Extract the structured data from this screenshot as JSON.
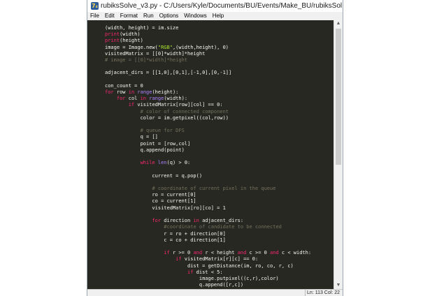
{
  "window": {
    "title": "rubiksSolve_v3.py - C:/Users/Kyle/Documents/BU/Events/Make_BU/rubiksSol..."
  },
  "menu": [
    "File",
    "Edit",
    "Format",
    "Run",
    "Options",
    "Windows",
    "Help"
  ],
  "code_lines": [
    [
      {
        "t": "(width, height) = im.size"
      }
    ],
    [
      {
        "t": "print",
        "c": "kw"
      },
      {
        "t": "(width)"
      }
    ],
    [
      {
        "t": "print",
        "c": "kw"
      },
      {
        "t": "(height)"
      }
    ],
    [
      {
        "t": "image = Image.new("
      },
      {
        "t": "\"RGB\"",
        "c": "str"
      },
      {
        "t": ",(width,height), 0)"
      }
    ],
    [
      {
        "t": "visitedMatrix = [[0]*width]*height"
      }
    ],
    [
      {
        "t": "# image = [[0]*width]*height",
        "c": "cm"
      }
    ],
    [],
    [
      {
        "t": "adjacent_dirs = [[1,0],[0,1],[-1,0],[0,-1]]"
      }
    ],
    [],
    [
      {
        "t": "con_count = 0"
      }
    ],
    [
      {
        "t": "for",
        "c": "kw"
      },
      {
        "t": " row "
      },
      {
        "t": "in",
        "c": "kw"
      },
      {
        "t": " "
      },
      {
        "t": "range",
        "c": "bi"
      },
      {
        "t": "(height):"
      }
    ],
    [
      {
        "t": "    "
      },
      {
        "t": "for",
        "c": "kw"
      },
      {
        "t": " col "
      },
      {
        "t": "in",
        "c": "kw"
      },
      {
        "t": " "
      },
      {
        "t": "range",
        "c": "bi"
      },
      {
        "t": "(width):"
      }
    ],
    [
      {
        "t": "        "
      },
      {
        "t": "if",
        "c": "kw"
      },
      {
        "t": " visitedMatrix[row][col] == 0:"
      }
    ],
    [
      {
        "t": "            "
      },
      {
        "t": "# color of connected component",
        "c": "cm"
      }
    ],
    [
      {
        "t": "            color = im.getpixel((col,row))"
      }
    ],
    [],
    [
      {
        "t": "            "
      },
      {
        "t": "# queue for DFS",
        "c": "cm"
      }
    ],
    [
      {
        "t": "            q = []"
      }
    ],
    [
      {
        "t": "            point = [row,col]"
      }
    ],
    [
      {
        "t": "            q.append(point)"
      }
    ],
    [],
    [
      {
        "t": "            "
      },
      {
        "t": "while",
        "c": "kw"
      },
      {
        "t": " "
      },
      {
        "t": "len",
        "c": "bi"
      },
      {
        "t": "(q) > 0:"
      }
    ],
    [],
    [
      {
        "t": "                current = q.pop()"
      }
    ],
    [],
    [
      {
        "t": "                "
      },
      {
        "t": "# coordinate of current pixel in the queue",
        "c": "cm"
      }
    ],
    [
      {
        "t": "                ro = current[0]"
      }
    ],
    [
      {
        "t": "                co = current[1]"
      }
    ],
    [
      {
        "t": "                visitedMatrix[ro][co] = 1"
      }
    ],
    [],
    [
      {
        "t": "                for",
        "c": "kw"
      },
      {
        "t": " direction "
      },
      {
        "t": "in",
        "c": "kw"
      },
      {
        "t": " adjacent_dirs:"
      }
    ],
    [
      {
        "t": "                    "
      },
      {
        "t": "#coordinate of candidate to be connected",
        "c": "cm"
      }
    ],
    [
      {
        "t": "                    r = ro + direction[0]"
      }
    ],
    [
      {
        "t": "                    c = co + direction[1]"
      }
    ],
    [],
    [
      {
        "t": "                    "
      },
      {
        "t": "if",
        "c": "kw"
      },
      {
        "t": " r >= 0 "
      },
      {
        "t": "and",
        "c": "kw"
      },
      {
        "t": " r < height "
      },
      {
        "t": "and",
        "c": "kw"
      },
      {
        "t": " c >= 0 "
      },
      {
        "t": "and",
        "c": "kw"
      },
      {
        "t": " c < width:"
      }
    ],
    [
      {
        "t": "                        "
      },
      {
        "t": "if",
        "c": "kw"
      },
      {
        "t": " visitedMatrix[r][c] == 0:"
      }
    ],
    [
      {
        "t": "                            dist = getDistance(im, ro, co, r, c)"
      }
    ],
    [
      {
        "t": "                            "
      },
      {
        "t": "if",
        "c": "kw"
      },
      {
        "t": " dist < 5:"
      }
    ],
    [
      {
        "t": "                                image.putpixel((c,r),color)"
      }
    ],
    [
      {
        "t": "                                q.append([r,c])"
      }
    ]
  ],
  "status": {
    "position": "Ln: 113 Col: 22"
  }
}
